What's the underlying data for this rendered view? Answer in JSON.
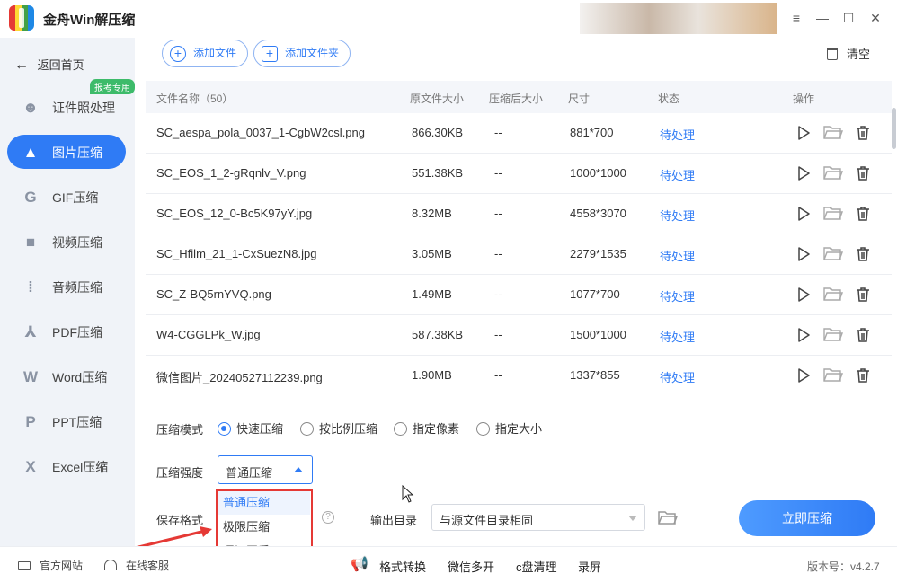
{
  "app": {
    "title": "金舟Win解压缩"
  },
  "window": {
    "min": "—",
    "restore": "☐",
    "close": "✕",
    "menu": "≡"
  },
  "sidebar": {
    "back_label": "返回首页",
    "badge": "报考专用",
    "items": [
      {
        "label": "证件照处理",
        "icon": "person-icon"
      },
      {
        "label": "图片压缩",
        "icon": "image-icon",
        "active": true
      },
      {
        "label": "GIF压缩",
        "icon": "gif-icon"
      },
      {
        "label": "视频压缩",
        "icon": "video-icon"
      },
      {
        "label": "音频压缩",
        "icon": "audio-icon"
      },
      {
        "label": "PDF压缩",
        "icon": "pdf-icon"
      },
      {
        "label": "Word压缩",
        "icon": "word-icon"
      },
      {
        "label": "PPT压缩",
        "icon": "ppt-icon"
      },
      {
        "label": "Excel压缩",
        "icon": "excel-icon"
      }
    ]
  },
  "toolbar": {
    "add_file": "添加文件",
    "add_folder": "添加文件夹",
    "clear": "清空"
  },
  "table": {
    "headers": {
      "name": "文件名称（50）",
      "orig": "原文件大小",
      "after": "压缩后大小",
      "dim": "尺寸",
      "status": "状态",
      "ops": "操作"
    },
    "rows": [
      {
        "name": "SC_aespa_pola_0037_1-CgbW2csl.png",
        "orig": "866.30KB",
        "after": "--",
        "dim": "881*700",
        "status": "待处理"
      },
      {
        "name": "SC_EOS_1_2-gRqnlv_V.png",
        "orig": "551.38KB",
        "after": "--",
        "dim": "1000*1000",
        "status": "待处理"
      },
      {
        "name": "SC_EOS_12_0-Bc5K97yY.jpg",
        "orig": "8.32MB",
        "after": "--",
        "dim": "4558*3070",
        "status": "待处理"
      },
      {
        "name": "SC_Hfilm_21_1-CxSuezN8.jpg",
        "orig": "3.05MB",
        "after": "--",
        "dim": "2279*1535",
        "status": "待处理"
      },
      {
        "name": "SC_Z-BQ5rnYVQ.png",
        "orig": "1.49MB",
        "after": "--",
        "dim": "1077*700",
        "status": "待处理"
      },
      {
        "name": "W4-CGGLPk_W.jpg",
        "orig": "587.38KB",
        "after": "--",
        "dim": "1500*1000",
        "status": "待处理"
      },
      {
        "name": "微信图片_20240527112239.png",
        "orig": "1.90MB",
        "after": "--",
        "dim": "1337*855",
        "status": "待处理"
      }
    ]
  },
  "settings": {
    "mode_label": "压缩模式",
    "modes": [
      "快速压缩",
      "按比例压缩",
      "指定像素",
      "指定大小"
    ],
    "strength_label": "压缩强度",
    "strength_value": "普通压缩",
    "strength_options": [
      "普通压缩",
      "极限压缩",
      "保证画质"
    ],
    "format_label": "保存格式",
    "help": "?",
    "output_label": "输出目录",
    "output_value": "与源文件目录相同",
    "compress_button": "立即压缩"
  },
  "footer": {
    "website": "官方网站",
    "support": "在线客服",
    "links": [
      "格式转换",
      "微信多开",
      "c盘清理",
      "录屏"
    ],
    "version": "版本号：v4.2.7"
  },
  "colors": {
    "accent": "#2f7bf5",
    "highlight": "#e53935",
    "badge": "#3dbb6a"
  }
}
